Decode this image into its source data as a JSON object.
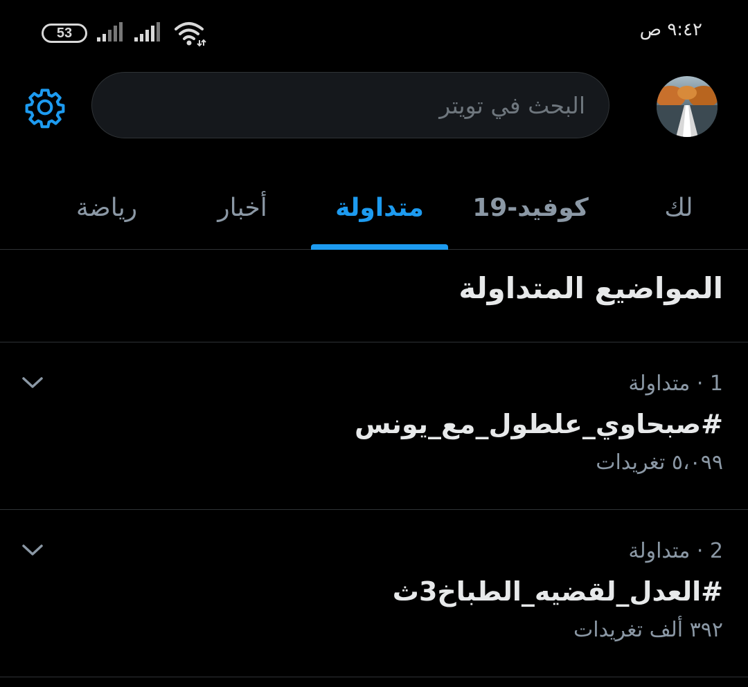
{
  "status_bar": {
    "battery": "53",
    "time": "٩:٤٢ ص"
  },
  "header": {
    "search_placeholder": "البحث في تويتر",
    "settings_icon": "gear-icon",
    "avatar_icon": "avatar"
  },
  "tabs": [
    {
      "label": "لك",
      "active": false
    },
    {
      "label": "كوفيد-19",
      "active": false
    },
    {
      "label": "متداولة",
      "active": true
    },
    {
      "label": "أخبار",
      "active": false
    },
    {
      "label": "رياضة",
      "active": false
    }
  ],
  "section": {
    "title": "المواضيع المتداولة"
  },
  "trends": [
    {
      "meta": "1 · متداولة",
      "name": "#صبحاوي_علطول_مع_يونس",
      "count": "٥،٠٩٩ تغريدات"
    },
    {
      "meta": "2 · متداولة",
      "name": "#العدل_لقضيه_الطباخ3ث",
      "count": "٣٩٢ ألف تغريدات"
    }
  ],
  "colors": {
    "accent": "#1d9bf0",
    "background": "#000000",
    "secondary_text": "#8b98a5"
  }
}
